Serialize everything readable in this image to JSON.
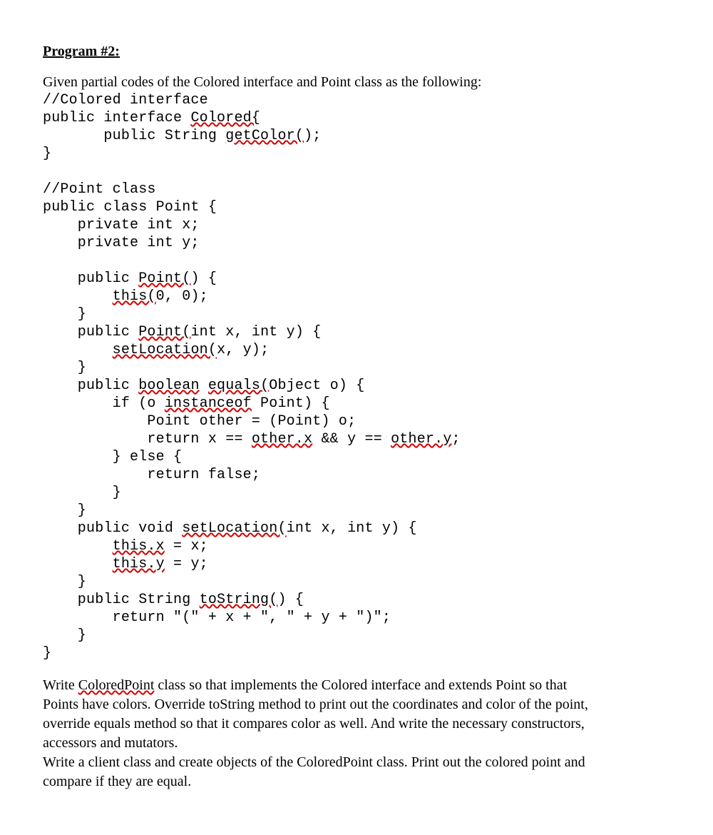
{
  "heading": "Program #2",
  "heading_colon": ":",
  "intro": "Given partial codes of the Colored interface and Point class as the following:",
  "code": {
    "c1": "//Colored interface",
    "c2a": "public interface ",
    "c2b": "Colored{",
    "c3a": "       public String ",
    "c3b": "getColor(",
    "c3c": ");",
    "c4": "}",
    "c5": "",
    "c6": "//Point class",
    "c7": "public class Point {",
    "c8": "    private int x;",
    "c9": "    private int y;",
    "c10": "",
    "c11a": "    public ",
    "c11b": "Point(",
    "c11c": ") {",
    "c12a": "        ",
    "c12b": "this(",
    "c12c": "0, 0);",
    "c13": "    }",
    "c14a": "    public ",
    "c14b": "Point(",
    "c14c": "int x, int y) {",
    "c15a": "        ",
    "c15b": "setLocation(",
    "c15c": "x, y);",
    "c16": "    }",
    "c17a": "    public ",
    "c17b": "boolean",
    "c17c": " ",
    "c17d": "equals(",
    "c17e": "Object o) {",
    "c18a": "        if (o ",
    "c18b": "instanceof",
    "c18c": " Point) {",
    "c19": "            Point other = (Point) o;",
    "c20a": "            return x == ",
    "c20b": "other.x",
    "c20c": " && y == ",
    "c20d": "other.y",
    "c20e": ";",
    "c21": "        } else {",
    "c22": "            return false;",
    "c23": "        }",
    "c24": "    }",
    "c25a": "    public void ",
    "c25b": "setLocation(",
    "c25c": "int x, int y) {",
    "c26a": "        ",
    "c26b": "this.x",
    "c26c": " = x;",
    "c27a": "        ",
    "c27b": "this.y",
    "c27c": " = y;",
    "c28": "    }",
    "c29a": "    public String ",
    "c29b": "toString(",
    "c29c": ") {",
    "c30": "        return \"(\" + x + \", \" + y + \")\";",
    "c31": "    }",
    "c32": "}"
  },
  "outro": {
    "p1a": "Write ",
    "p1b": "ColoredPoint",
    "p1c": " class so that implements the Colored interface and extends Point so that",
    "p2": "Points have colors. Override toString method to print out the coordinates and color of the point,",
    "p3": "override equals method so that it compares color as well. And write the necessary constructors,",
    "p4": "accessors and mutators.",
    "p5": "Write a client class and create objects of the ColoredPoint class. Print out the colored point and",
    "p6": "compare if they are equal."
  }
}
